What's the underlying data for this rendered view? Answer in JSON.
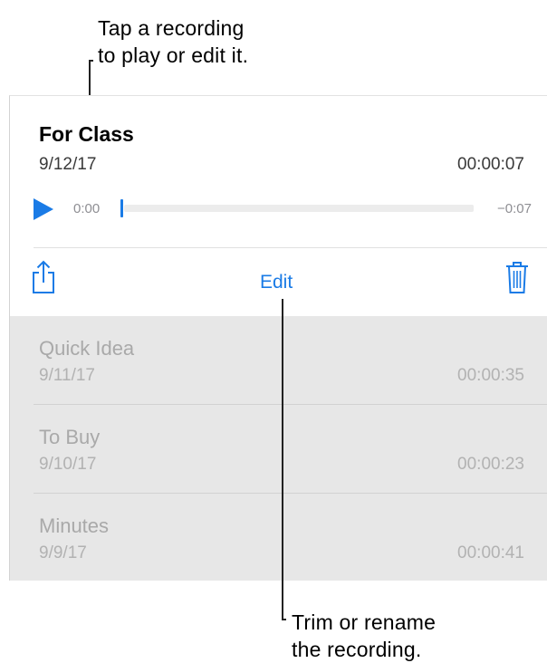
{
  "callouts": {
    "top_line1": "Tap a recording",
    "top_line2": "to play or edit it.",
    "bottom_line1": "Trim or rename",
    "bottom_line2": "the recording."
  },
  "expanded": {
    "title": "For Class",
    "date": "9/12/17",
    "duration": "00:00:07",
    "time_start": "0:00",
    "time_remaining": "−0:07",
    "progress": 0.0,
    "edit_label": "Edit",
    "icons": {
      "play": "play-icon",
      "share": "share-icon",
      "trash": "trash-icon"
    }
  },
  "recordings": [
    {
      "title": "Quick Idea",
      "date": "9/11/17",
      "duration": "00:00:35"
    },
    {
      "title": "To Buy",
      "date": "9/10/17",
      "duration": "00:00:23"
    },
    {
      "title": "Minutes",
      "date": "9/9/17",
      "duration": "00:00:41"
    }
  ],
  "colors": {
    "accent": "#1a7be6",
    "list_background": "#e7e7e7",
    "dimmed_text": "#a9a9a9"
  }
}
